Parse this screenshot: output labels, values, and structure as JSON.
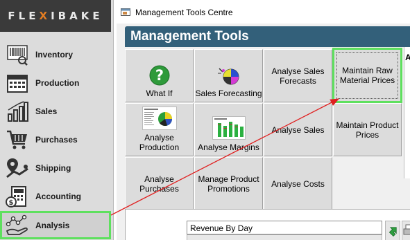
{
  "sidebar": {
    "logo": {
      "text_a": "FLE",
      "text_b": "X",
      "text_c": "I",
      "text_d": "BAKE"
    },
    "items": [
      {
        "label": "Inventory",
        "icon": "barcode-icon"
      },
      {
        "label": "Production",
        "icon": "calendar-icon"
      },
      {
        "label": "Sales",
        "icon": "bar-chart-icon"
      },
      {
        "label": "Purchases",
        "icon": "shopping-cart-icon"
      },
      {
        "label": "Shipping",
        "icon": "map-pin-icon"
      },
      {
        "label": "Accounting",
        "icon": "calculator-icon"
      },
      {
        "label": "Analysis",
        "icon": "line-graph-hand-icon"
      }
    ],
    "selected": "Analysis",
    "highlight_color": "#5ee05e"
  },
  "window": {
    "title": "Management Tools Centre"
  },
  "panel": {
    "header": "Management Tools",
    "header_color": "#33607a",
    "tiles": [
      {
        "label": "What If",
        "icon": "question-icon"
      },
      {
        "label": "Sales Forecasting",
        "icon": "pie-chart-icon"
      },
      {
        "label": "Analyse Sales Forecasts"
      },
      {
        "label": "Maintain Raw Material Prices"
      },
      {
        "label": "Analyse Production",
        "icon": "report-thumbnail-icon"
      },
      {
        "label": "Analyse Margins",
        "icon": "bar-report-icon"
      },
      {
        "label": "Analyse Sales"
      },
      {
        "label": "Maintain Product Prices"
      },
      {
        "label": "Analyse Purchases"
      },
      {
        "label": "Manage Product Promotions"
      },
      {
        "label": "Analyse Costs"
      }
    ],
    "right_strip_label": "A",
    "report_select": {
      "value": "Revenue By Day"
    }
  },
  "annotation": {
    "arrow_color": "#e02020"
  }
}
